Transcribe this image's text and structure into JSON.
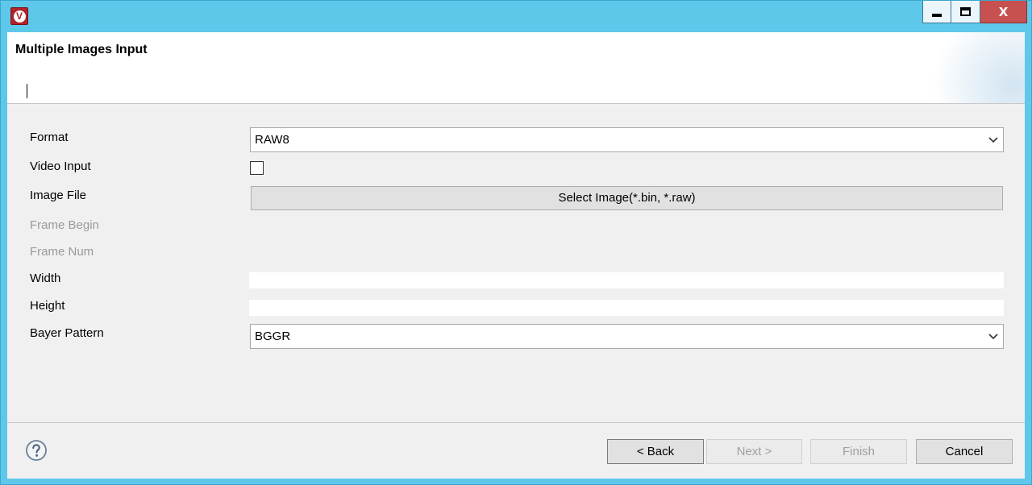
{
  "window": {
    "app_icon_letter": "V",
    "minimize_icon": "minimize-icon",
    "maximize_icon": "maximize-icon",
    "close_icon": "close-icon",
    "close_glyph": "X"
  },
  "header": {
    "title": "Multiple Images Input"
  },
  "form": {
    "format": {
      "label": "Format",
      "value": "RAW8"
    },
    "video_input": {
      "label": "Video Input",
      "checked": false
    },
    "image_file": {
      "label": "Image File",
      "button": "Select Image(*.bin, *.raw)"
    },
    "frame_begin": {
      "label": "Frame Begin"
    },
    "frame_num": {
      "label": "Frame Num"
    },
    "width": {
      "label": "Width",
      "value": ""
    },
    "height": {
      "label": "Height",
      "value": ""
    },
    "bayer_pattern": {
      "label": "Bayer Pattern",
      "value": "BGGR"
    }
  },
  "footer": {
    "help_icon": "help-icon",
    "back": "< Back",
    "next": "Next >",
    "finish": "Finish",
    "cancel": "Cancel"
  },
  "colors": {
    "frame": "#5ec8ea",
    "close_button": "#c75050",
    "app_icon": "#b3222a"
  }
}
